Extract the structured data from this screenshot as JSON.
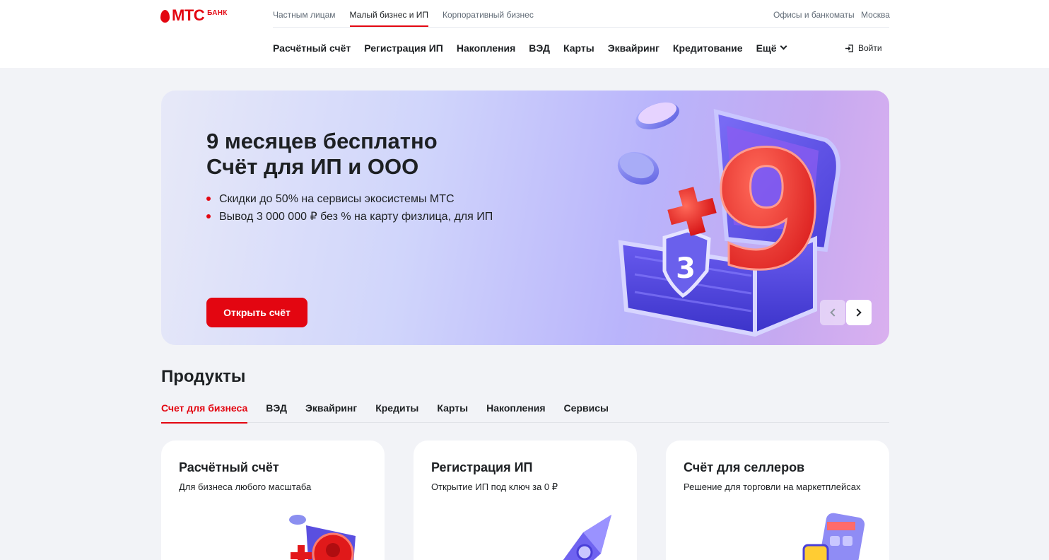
{
  "brand": {
    "name": "МТС",
    "suffix": "БАНК",
    "color": "#e30611"
  },
  "segments": [
    {
      "label": "Частным лицам",
      "active": false
    },
    {
      "label": "Малый бизнес и ИП",
      "active": true
    },
    {
      "label": "Корпоративный бизнес",
      "active": false
    }
  ],
  "utility": {
    "offices": "Офисы и банкоматы",
    "city": "Москва"
  },
  "main_nav": [
    "Расчётный счёт",
    "Регистрация ИП",
    "Накопления",
    "ВЭД",
    "Карты",
    "Эквайринг",
    "Кредитование",
    "Ещё"
  ],
  "login": {
    "label": "Войти",
    "icon": "login-icon"
  },
  "banner": {
    "title_line1": "9 месяцев бесплатно",
    "title_line2": "Счёт для ИП и ООО",
    "bullets": [
      "Скидки до 50% на сервисы экосистемы МТС",
      "Вывод 3 000 000 ₽ без % на карту физлица, для ИП"
    ],
    "cta": "Открыть счёт",
    "badge_digit": "3",
    "big_digit": "9"
  },
  "products": {
    "title": "Продукты",
    "tabs": [
      {
        "label": "Счет для бизнеса",
        "active": true
      },
      {
        "label": "ВЭД",
        "active": false
      },
      {
        "label": "Эквайринг",
        "active": false
      },
      {
        "label": "Кредиты",
        "active": false
      },
      {
        "label": "Карты",
        "active": false
      },
      {
        "label": "Накопления",
        "active": false
      },
      {
        "label": "Сервисы",
        "active": false
      }
    ],
    "cards": [
      {
        "title": "Расчётный счёт",
        "subtitle": "Для бизнеса любого масштаба"
      },
      {
        "title": "Регистрация ИП",
        "subtitle": "Открытие ИП под ключ за 0 ₽"
      },
      {
        "title": "Счёт для селлеров",
        "subtitle": "Решение для торговли на маркетплейсах"
      }
    ]
  }
}
